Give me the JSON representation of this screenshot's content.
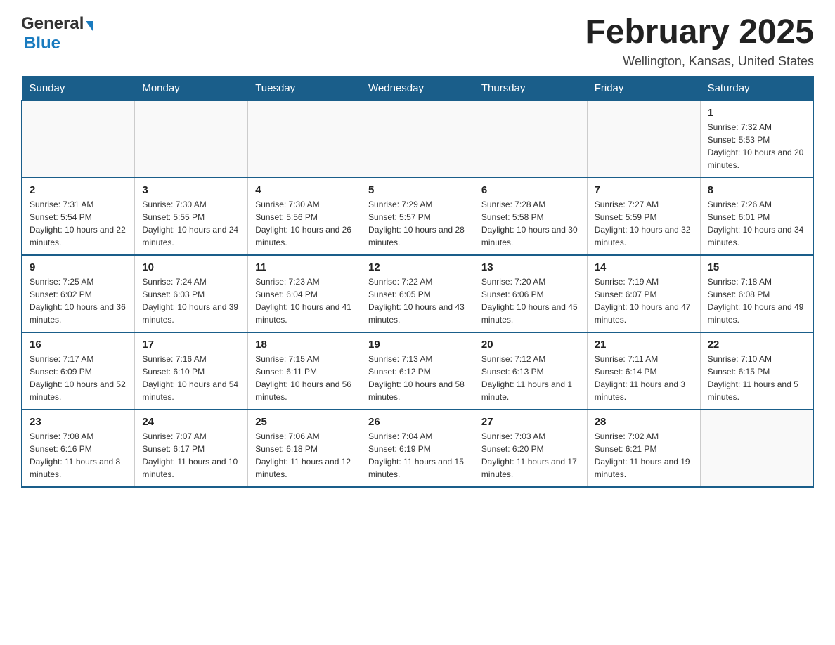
{
  "header": {
    "logo": {
      "general": "General",
      "blue": "Blue"
    },
    "title": "February 2025",
    "subtitle": "Wellington, Kansas, United States"
  },
  "weekdays": [
    "Sunday",
    "Monday",
    "Tuesday",
    "Wednesday",
    "Thursday",
    "Friday",
    "Saturday"
  ],
  "weeks": [
    [
      {
        "day": "",
        "sunrise": "",
        "sunset": "",
        "daylight": ""
      },
      {
        "day": "",
        "sunrise": "",
        "sunset": "",
        "daylight": ""
      },
      {
        "day": "",
        "sunrise": "",
        "sunset": "",
        "daylight": ""
      },
      {
        "day": "",
        "sunrise": "",
        "sunset": "",
        "daylight": ""
      },
      {
        "day": "",
        "sunrise": "",
        "sunset": "",
        "daylight": ""
      },
      {
        "day": "",
        "sunrise": "",
        "sunset": "",
        "daylight": ""
      },
      {
        "day": "1",
        "sunrise": "Sunrise: 7:32 AM",
        "sunset": "Sunset: 5:53 PM",
        "daylight": "Daylight: 10 hours and 20 minutes."
      }
    ],
    [
      {
        "day": "2",
        "sunrise": "Sunrise: 7:31 AM",
        "sunset": "Sunset: 5:54 PM",
        "daylight": "Daylight: 10 hours and 22 minutes."
      },
      {
        "day": "3",
        "sunrise": "Sunrise: 7:30 AM",
        "sunset": "Sunset: 5:55 PM",
        "daylight": "Daylight: 10 hours and 24 minutes."
      },
      {
        "day": "4",
        "sunrise": "Sunrise: 7:30 AM",
        "sunset": "Sunset: 5:56 PM",
        "daylight": "Daylight: 10 hours and 26 minutes."
      },
      {
        "day": "5",
        "sunrise": "Sunrise: 7:29 AM",
        "sunset": "Sunset: 5:57 PM",
        "daylight": "Daylight: 10 hours and 28 minutes."
      },
      {
        "day": "6",
        "sunrise": "Sunrise: 7:28 AM",
        "sunset": "Sunset: 5:58 PM",
        "daylight": "Daylight: 10 hours and 30 minutes."
      },
      {
        "day": "7",
        "sunrise": "Sunrise: 7:27 AM",
        "sunset": "Sunset: 5:59 PM",
        "daylight": "Daylight: 10 hours and 32 minutes."
      },
      {
        "day": "8",
        "sunrise": "Sunrise: 7:26 AM",
        "sunset": "Sunset: 6:01 PM",
        "daylight": "Daylight: 10 hours and 34 minutes."
      }
    ],
    [
      {
        "day": "9",
        "sunrise": "Sunrise: 7:25 AM",
        "sunset": "Sunset: 6:02 PM",
        "daylight": "Daylight: 10 hours and 36 minutes."
      },
      {
        "day": "10",
        "sunrise": "Sunrise: 7:24 AM",
        "sunset": "Sunset: 6:03 PM",
        "daylight": "Daylight: 10 hours and 39 minutes."
      },
      {
        "day": "11",
        "sunrise": "Sunrise: 7:23 AM",
        "sunset": "Sunset: 6:04 PM",
        "daylight": "Daylight: 10 hours and 41 minutes."
      },
      {
        "day": "12",
        "sunrise": "Sunrise: 7:22 AM",
        "sunset": "Sunset: 6:05 PM",
        "daylight": "Daylight: 10 hours and 43 minutes."
      },
      {
        "day": "13",
        "sunrise": "Sunrise: 7:20 AM",
        "sunset": "Sunset: 6:06 PM",
        "daylight": "Daylight: 10 hours and 45 minutes."
      },
      {
        "day": "14",
        "sunrise": "Sunrise: 7:19 AM",
        "sunset": "Sunset: 6:07 PM",
        "daylight": "Daylight: 10 hours and 47 minutes."
      },
      {
        "day": "15",
        "sunrise": "Sunrise: 7:18 AM",
        "sunset": "Sunset: 6:08 PM",
        "daylight": "Daylight: 10 hours and 49 minutes."
      }
    ],
    [
      {
        "day": "16",
        "sunrise": "Sunrise: 7:17 AM",
        "sunset": "Sunset: 6:09 PM",
        "daylight": "Daylight: 10 hours and 52 minutes."
      },
      {
        "day": "17",
        "sunrise": "Sunrise: 7:16 AM",
        "sunset": "Sunset: 6:10 PM",
        "daylight": "Daylight: 10 hours and 54 minutes."
      },
      {
        "day": "18",
        "sunrise": "Sunrise: 7:15 AM",
        "sunset": "Sunset: 6:11 PM",
        "daylight": "Daylight: 10 hours and 56 minutes."
      },
      {
        "day": "19",
        "sunrise": "Sunrise: 7:13 AM",
        "sunset": "Sunset: 6:12 PM",
        "daylight": "Daylight: 10 hours and 58 minutes."
      },
      {
        "day": "20",
        "sunrise": "Sunrise: 7:12 AM",
        "sunset": "Sunset: 6:13 PM",
        "daylight": "Daylight: 11 hours and 1 minute."
      },
      {
        "day": "21",
        "sunrise": "Sunrise: 7:11 AM",
        "sunset": "Sunset: 6:14 PM",
        "daylight": "Daylight: 11 hours and 3 minutes."
      },
      {
        "day": "22",
        "sunrise": "Sunrise: 7:10 AM",
        "sunset": "Sunset: 6:15 PM",
        "daylight": "Daylight: 11 hours and 5 minutes."
      }
    ],
    [
      {
        "day": "23",
        "sunrise": "Sunrise: 7:08 AM",
        "sunset": "Sunset: 6:16 PM",
        "daylight": "Daylight: 11 hours and 8 minutes."
      },
      {
        "day": "24",
        "sunrise": "Sunrise: 7:07 AM",
        "sunset": "Sunset: 6:17 PM",
        "daylight": "Daylight: 11 hours and 10 minutes."
      },
      {
        "day": "25",
        "sunrise": "Sunrise: 7:06 AM",
        "sunset": "Sunset: 6:18 PM",
        "daylight": "Daylight: 11 hours and 12 minutes."
      },
      {
        "day": "26",
        "sunrise": "Sunrise: 7:04 AM",
        "sunset": "Sunset: 6:19 PM",
        "daylight": "Daylight: 11 hours and 15 minutes."
      },
      {
        "day": "27",
        "sunrise": "Sunrise: 7:03 AM",
        "sunset": "Sunset: 6:20 PM",
        "daylight": "Daylight: 11 hours and 17 minutes."
      },
      {
        "day": "28",
        "sunrise": "Sunrise: 7:02 AM",
        "sunset": "Sunset: 6:21 PM",
        "daylight": "Daylight: 11 hours and 19 minutes."
      },
      {
        "day": "",
        "sunrise": "",
        "sunset": "",
        "daylight": ""
      }
    ]
  ]
}
